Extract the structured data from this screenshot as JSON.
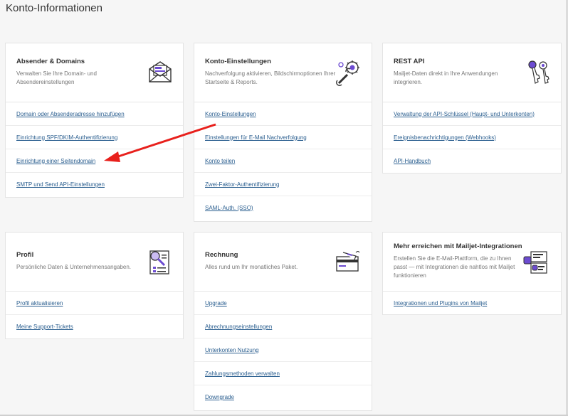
{
  "page": {
    "title": "Konto-Informationen"
  },
  "colors": {
    "link": "#2a5e8f",
    "arrow": "#e8201c",
    "icon_accent": "#6c4bd1"
  },
  "cards": [
    {
      "title": "Absender & Domains",
      "desc": "Verwalten Sie Ihre Domain- und Absendereinstellungen",
      "icon": "envelope-icon",
      "links": [
        "Domain oder Absenderadresse hinzufügen",
        "Einrichtung SPF/DKIM-Authentifizierung",
        "Einrichtung einer Seitendomain",
        "SMTP und Send API-Einstellungen"
      ]
    },
    {
      "title": "Konto-Einstellungen",
      "desc": "Nachverfolgung aktivieren, Bildschirmoptionen Ihrer Startseite & Reports.",
      "icon": "wrench-gear-icon",
      "links": [
        "Konto-Einstellungen",
        "Einstellungen für E-Mail Nachverfolgung",
        "Konto teilen",
        "Zwei-Faktor-Authentifizierung",
        "SAML-Auth. (SSO)"
      ]
    },
    {
      "title": "REST API",
      "desc": "Mailjet-Daten direkt in Ihre Anwendungen integrieren.",
      "icon": "keys-icon",
      "links": [
        "Verwaltung der API-Schlüssel (Haupt- und Unterkonten)",
        "Ereignisbenachrichtigungen (Webhooks)",
        "API-Handbuch"
      ]
    },
    {
      "title": "Profil",
      "desc": "Persönliche Daten & Unternehmensangaben.",
      "icon": "profile-search-icon",
      "links": [
        "Profil aktualisieren",
        "Meine Support-Tickets"
      ]
    },
    {
      "title": "Rechnung",
      "desc": "Alles rund um Ihr monatliches Paket.",
      "icon": "credit-card-icon",
      "links": [
        "Upgrade",
        "Abrechnungseinstellungen",
        "Unterkonten Nutzung",
        "Zahlungsmethoden verwalten",
        "Downgrade"
      ]
    },
    {
      "title": "Mehr erreichen mit Mailjet-Integrationen",
      "desc": "Erstellen Sie die E-Mail-Plattform, die zu Ihnen passt — mit Integrationen die nahtlos mit Mailjet funktionieren",
      "icon": "integrations-icon",
      "links": [
        "Integrationen und Plugins von Mailjet"
      ]
    }
  ]
}
